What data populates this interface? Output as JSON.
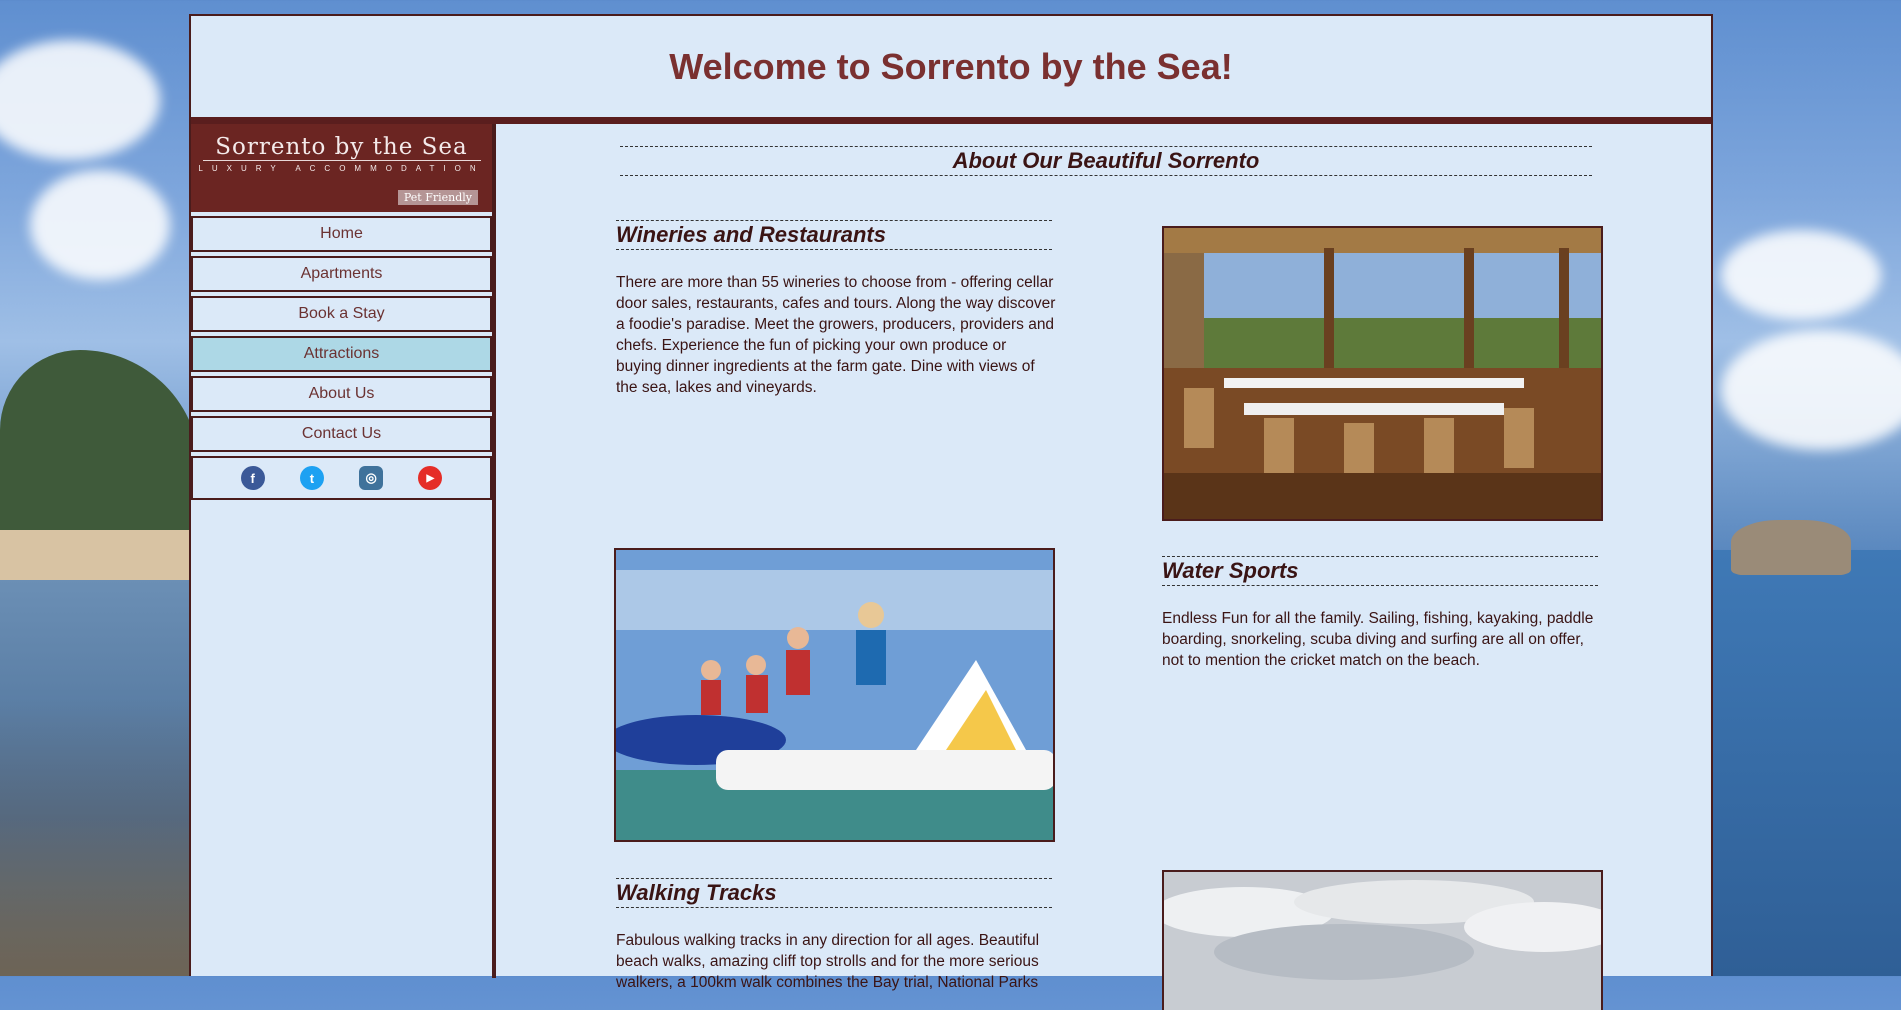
{
  "header": {
    "title": "Welcome to Sorrento by the Sea!"
  },
  "logo": {
    "title": "Sorrento by the Sea",
    "subtitle": "LUXURY ACCOMMODATION",
    "badge": "Pet Friendly"
  },
  "nav": {
    "items": [
      {
        "label": "Home"
      },
      {
        "label": "Apartments"
      },
      {
        "label": "Book a Stay"
      },
      {
        "label": "Attractions"
      },
      {
        "label": "About Us"
      },
      {
        "label": "Contact Us"
      }
    ],
    "active": "Attractions"
  },
  "social": {
    "facebook": {
      "icon": "facebook-icon",
      "glyph": "f",
      "color": "#3b5998"
    },
    "twitter": {
      "icon": "twitter-icon",
      "glyph": "t",
      "color": "#1da1f2"
    },
    "instagram": {
      "icon": "instagram-icon",
      "glyph": "◎",
      "color": "#3f729b"
    },
    "youtube": {
      "icon": "youtube-icon",
      "glyph": "▶",
      "color": "#e52d27"
    }
  },
  "main": {
    "about_title": "About Our Beautiful Sorrento",
    "sections": [
      {
        "title": "Wineries and Restaurants",
        "text": "There are more than 55 wineries to choose from - offering cellar door sales, restaurants, cafes and tours. Along the way discover a foodie's paradise. Meet the growers, producers, providers and chefs. Experience the fun of picking your own produce or buying dinner ingredients at the farm gate. Dine with views of the sea, lakes and vineyards."
      },
      {
        "title": "Water Sports",
        "text": "Endless Fun for all the family. Sailing, fishing, kayaking, paddle boarding, snorkeling, scuba diving and surfing are all on offer, not to mention the cricket match on the beach."
      },
      {
        "title": "Walking Tracks",
        "text": "Fabulous walking tracks in any direction for all ages. Beautiful beach walks, amazing cliff top strolls and for the more serious walkers, a 100km walk combines the Bay trial, National Parks"
      }
    ]
  },
  "colors": {
    "accent": "#6b2522",
    "title": "#7a3030",
    "panel": "#dbe9f8",
    "active_nav": "#add8e6"
  }
}
